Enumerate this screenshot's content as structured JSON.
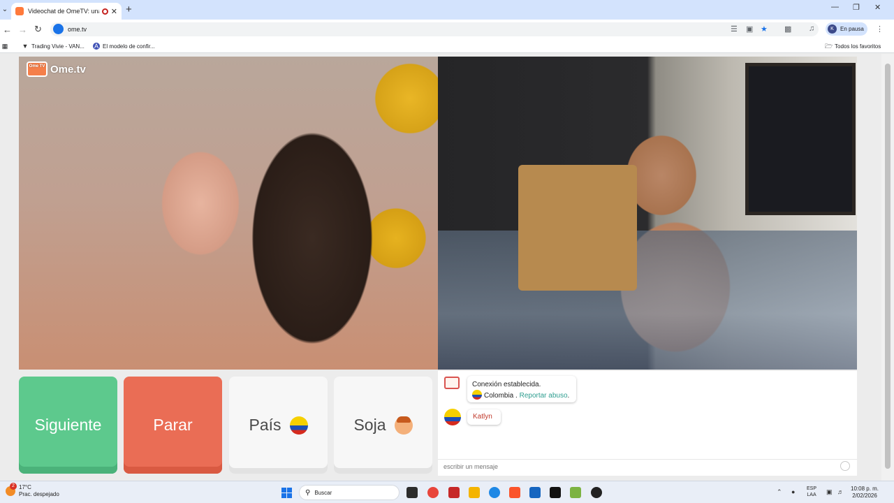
{
  "browser": {
    "tab_title": "Videochat de OmeTV: una",
    "url": "ome.tv",
    "profile_initial": "K",
    "profile_status": "En pausa",
    "bookmarks": [
      {
        "label": "Trading Vivie - VAN..."
      },
      {
        "label": "El modelo de confir..."
      }
    ],
    "all_favorites": "Todos los favoritos"
  },
  "site": {
    "logo_text": "Ome.tv",
    "logo_tv": "Ome TV"
  },
  "controls": {
    "next_label": "Siguiente",
    "stop_label": "Parar",
    "country_label": "País",
    "gender_label": "Soja"
  },
  "chat": {
    "system_message": "Conexión establecida.",
    "country": "Colombia",
    "separator": ".",
    "report_link": "Reportar abuso",
    "report_suffix": ".",
    "partner_name": "Katlyn",
    "input_placeholder": "escribir un mensaje"
  },
  "taskbar": {
    "weather_badge": "2",
    "temperature": "17°C",
    "weather_desc": "Prac. despejado",
    "search_label": "Buscar",
    "lang_top": "ESP",
    "lang_bottom": "LAA",
    "time": "10:08 p. m.",
    "date": "2/02/2026"
  },
  "colors": {
    "next": "#5dc98d",
    "stop": "#ea6d55",
    "chrome_tab_strip": "#d3e3fd",
    "report_link": "#2d9d8f",
    "partner_name": "#c0392b"
  },
  "icons": [
    "tab-list-icon",
    "new-tab-icon",
    "back-icon",
    "forward-icon",
    "reload-icon",
    "translate-icon",
    "install-icon",
    "star-icon",
    "extensions-icon",
    "media-icon",
    "menu-icon",
    "apps-icon",
    "folder-icon",
    "emoji-icon",
    "windows-icon",
    "search-icon"
  ]
}
